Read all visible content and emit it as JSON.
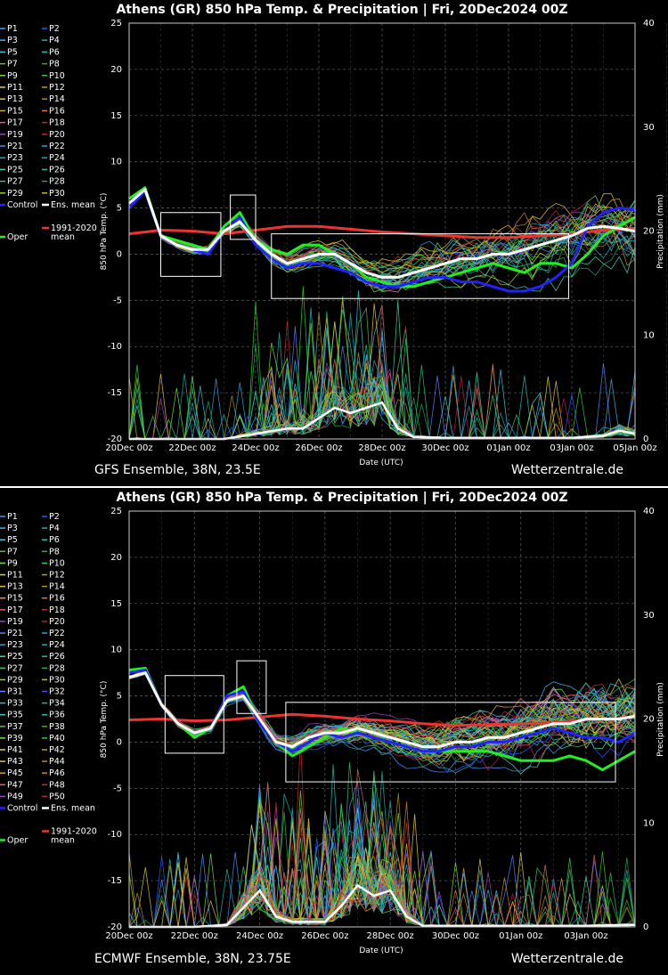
{
  "page": {
    "brand": "Wetterzentrale.de"
  },
  "chart_data": [
    {
      "type": "line",
      "title": "Athens  (GR)  850 hPa Temp. & Precipitation | Fri, 20Dec2024 00Z",
      "model": "GFS Ensemble, 38N, 23.5E",
      "source": "Wetterzentrale.de",
      "xlabel": "Date (UTC)",
      "ylabel": "850 hPa Temp. (°C)",
      "y2label": "Precipitation (mm)",
      "x_ticks": [
        "20Dec 00z",
        "22Dec 00z",
        "24Dec 00z",
        "26Dec 00z",
        "28Dec 00z",
        "30Dec 00z",
        "01Jan 00z",
        "03Jan 00z",
        "05Jan 00z"
      ],
      "x_range_days": [
        0,
        16
      ],
      "ylim": [
        -20,
        25
      ],
      "y_ticks": [
        "25",
        "20",
        "15",
        "10",
        "5",
        "0",
        "-5",
        "-10",
        "-15",
        "-20"
      ],
      "y2lim": [
        0,
        40
      ],
      "y2_ticks": [
        "40",
        "30",
        "20",
        "10",
        "0"
      ],
      "grid": true,
      "legend_position": "left",
      "members": [
        "P1",
        "P2",
        "P3",
        "P4",
        "P5",
        "P6",
        "P7",
        "P8",
        "P9",
        "P10",
        "P11",
        "P12",
        "P13",
        "P14",
        "P15",
        "P16",
        "P17",
        "P18",
        "P19",
        "P20",
        "P21",
        "P22",
        "P23",
        "P24",
        "P25",
        "P26",
        "P27",
        "P28",
        "P29",
        "P30"
      ],
      "legend_extra": {
        "control": "Control",
        "ens_mean": "Ens. mean",
        "climate": "1991-2020 mean",
        "oper": "Oper"
      },
      "colors": {
        "control": "#2222ff",
        "ens_mean": "#ffffff",
        "climate": "#ee3333",
        "oper": "#22ee22"
      },
      "series": [
        {
          "name": "Ens. mean",
          "x_days": [
            0,
            0.5,
            1,
            1.5,
            2,
            2.5,
            3,
            3.5,
            4,
            4.5,
            5,
            5.5,
            6,
            6.5,
            7,
            7.5,
            8,
            8.5,
            9,
            9.5,
            10,
            10.5,
            11,
            11.5,
            12,
            12.5,
            13,
            13.5,
            14,
            14.5,
            15,
            15.5,
            16
          ],
          "values": [
            5.5,
            7,
            2,
            1,
            0.5,
            0.5,
            2.5,
            3.5,
            1.5,
            0,
            -1,
            -0.5,
            0,
            0,
            -1,
            -2,
            -2.5,
            -2.5,
            -2,
            -1.5,
            -1,
            -0.5,
            -0.5,
            0,
            0,
            0.5,
            1,
            1.5,
            2,
            2.8,
            3,
            2.8,
            2.5
          ]
        },
        {
          "name": "Control",
          "x_days": [
            0,
            0.5,
            1,
            1.5,
            2,
            2.5,
            3,
            3.5,
            4,
            4.5,
            5,
            5.5,
            6,
            6.5,
            7,
            7.5,
            8,
            8.5,
            9,
            9.5,
            10,
            10.5,
            11,
            11.5,
            12,
            12.5,
            13,
            13.5,
            14,
            14.5,
            15,
            15.5,
            16
          ],
          "values": [
            5,
            6.8,
            2,
            1,
            0.5,
            0,
            2.5,
            4,
            1,
            -0.5,
            -1.5,
            -1,
            -1,
            -1.5,
            -2,
            -3,
            -3.5,
            -3.5,
            -3,
            -2.5,
            -2.5,
            -3,
            -3,
            -3.5,
            -4,
            -4,
            -3.5,
            -2.5,
            -1,
            3,
            4.5,
            5,
            4.8
          ]
        },
        {
          "name": "Oper",
          "x_days": [
            0,
            0.5,
            1,
            1.5,
            2,
            2.5,
            3,
            3.5,
            4,
            4.5,
            5,
            5.5,
            6,
            6.5,
            7,
            7.5,
            8,
            8.5,
            9,
            9.5,
            10,
            10.5,
            11,
            11.5,
            12,
            12.5,
            13,
            13.5,
            14,
            14.5,
            15,
            15.5,
            16
          ],
          "values": [
            6,
            7.2,
            2,
            1.5,
            1,
            0.5,
            3,
            4.5,
            1.5,
            0.5,
            0,
            1,
            1,
            0,
            -1,
            -2.5,
            -3,
            -3.5,
            -3.5,
            -3,
            -2.5,
            -2,
            -1.5,
            -1,
            -1.5,
            -2,
            -1,
            -1,
            -1.5,
            0,
            2,
            3,
            4
          ]
        },
        {
          "name": "1991-2020 mean",
          "x_days": [
            0,
            1,
            2,
            3,
            4,
            5,
            6,
            7,
            8,
            9,
            10,
            11,
            12,
            13,
            14,
            15,
            16
          ],
          "values": [
            2.2,
            2.6,
            2.5,
            2.2,
            2.6,
            3.0,
            3.0,
            2.7,
            2.4,
            2.2,
            2.0,
            1.8,
            1.8,
            2.0,
            2.2,
            2.6,
            2.8
          ]
        }
      ],
      "precip_mean": {
        "x_days": [
          0,
          1,
          2,
          3,
          4,
          5,
          5.5,
          6,
          6.5,
          7,
          7.5,
          8,
          8.5,
          9,
          10,
          12,
          14,
          15,
          15.5,
          16
        ],
        "values": [
          0,
          0,
          0,
          0,
          0.5,
          1,
          1,
          2,
          3,
          2.5,
          3,
          3.5,
          1,
          0.2,
          0.1,
          0.1,
          0.1,
          0.3,
          0.8,
          0.5
        ]
      },
      "highlight_boxes_days_temp": [
        [
          1,
          2.9,
          -2.4,
          4.5
        ],
        [
          3.2,
          4,
          1.6,
          6.4
        ],
        [
          4.5,
          13.9,
          -4.8,
          2.2
        ]
      ]
    },
    {
      "type": "line",
      "title": "Athens  (GR)  850 hPa Temp. & Precipitation | Fri, 20Dec2024 00Z",
      "model": "ECMWF Ensemble, 38N, 23.75E",
      "source": "Wetterzentrale.de",
      "xlabel": "Date (UTC)",
      "ylabel": "850 hPa Temp. (°C)",
      "y2label": "Precipitation (mm)",
      "x_ticks": [
        "20Dec 00z",
        "22Dec 00z",
        "24Dec 00z",
        "26Dec 00z",
        "28Dec 00z",
        "30Dec 00z",
        "01Jan 00z",
        "03Jan 00z"
      ],
      "x_range_days": [
        0,
        15.5
      ],
      "ylim": [
        -20,
        25
      ],
      "y_ticks": [
        "25",
        "20",
        "15",
        "10",
        "5",
        "0",
        "-5",
        "-10",
        "-15",
        "-20"
      ],
      "y2lim": [
        0,
        40
      ],
      "y2_ticks": [
        "40",
        "30",
        "20",
        "10",
        "0"
      ],
      "grid": true,
      "legend_position": "left",
      "members": [
        "P1",
        "P2",
        "P3",
        "P4",
        "P5",
        "P6",
        "P7",
        "P8",
        "P9",
        "P10",
        "P11",
        "P12",
        "P13",
        "P14",
        "P15",
        "P16",
        "P17",
        "P18",
        "P19",
        "P20",
        "P21",
        "P22",
        "P23",
        "P24",
        "P25",
        "P26",
        "P27",
        "P28",
        "P29",
        "P30",
        "P31",
        "P32",
        "P33",
        "P34",
        "P35",
        "P36",
        "P37",
        "P38",
        "P39",
        "P40",
        "P41",
        "P42",
        "P43",
        "P44",
        "P45",
        "P46",
        "P47",
        "P48",
        "P49",
        "P50"
      ],
      "legend_extra": {
        "control": "Control",
        "ens_mean": "Ens. mean",
        "climate": "1991-2020 mean",
        "oper": "Oper"
      },
      "colors": {
        "control": "#2222ff",
        "ens_mean": "#ffffff",
        "climate": "#ee3333",
        "oper": "#22ee22"
      },
      "series": [
        {
          "name": "Ens. mean",
          "x_days": [
            0,
            0.5,
            1,
            1.5,
            2,
            2.5,
            3,
            3.5,
            4,
            4.5,
            5,
            5.5,
            6,
            6.5,
            7,
            7.5,
            8,
            8.5,
            9,
            9.5,
            10,
            10.5,
            11,
            11.5,
            12,
            12.5,
            13,
            13.5,
            14,
            14.5,
            15,
            15.5
          ],
          "values": [
            7,
            7.5,
            4,
            2,
            1,
            1.5,
            4.5,
            5,
            2.5,
            0,
            -0.5,
            0.5,
            1,
            1,
            1.5,
            1,
            0.5,
            0,
            -0.5,
            -0.5,
            0,
            0,
            0.5,
            0.5,
            1,
            1.5,
            2,
            2,
            2.5,
            2.5,
            2.5,
            2.8
          ]
        },
        {
          "name": "Control",
          "x_days": [
            0,
            0.5,
            1,
            1.5,
            2,
            2.5,
            3,
            3.5,
            4,
            4.5,
            5,
            5.5,
            6,
            6.5,
            7,
            7.5,
            8,
            8.5,
            9,
            9.5,
            10,
            10.5,
            11,
            11.5,
            12,
            12.5,
            13,
            13.5,
            14,
            14.5,
            15,
            15.5
          ],
          "values": [
            7.5,
            7.8,
            4,
            2,
            1,
            1.5,
            5,
            5.5,
            2,
            0,
            -1,
            0,
            1,
            0.5,
            1,
            0.5,
            0,
            -0.5,
            -1,
            -1,
            -0.5,
            -0.5,
            0,
            0,
            0.5,
            1,
            1.5,
            1,
            0.5,
            0.5,
            0,
            1
          ]
        },
        {
          "name": "Oper",
          "x_days": [
            0,
            0.5,
            1,
            1.5,
            2,
            2.5,
            3,
            3.5,
            4,
            4.5,
            5,
            5.5,
            6,
            6.5,
            7,
            7.5,
            8,
            8.5,
            9,
            9.5,
            10,
            10.5,
            11,
            11.5,
            12,
            12.5,
            13,
            13.5,
            14,
            14.5,
            15,
            15.5
          ],
          "values": [
            7.8,
            8,
            4,
            2,
            0.5,
            1.5,
            5,
            6,
            2,
            0,
            -1.5,
            -0.5,
            0.5,
            1.5,
            1,
            0.5,
            0,
            -0.5,
            -1,
            -1,
            -1,
            -1,
            -1,
            -1.5,
            -2,
            -2,
            -2,
            -1.5,
            -2,
            -3,
            -2,
            -1
          ]
        },
        {
          "name": "1991-2020 mean",
          "x_days": [
            0,
            1,
            2,
            3,
            4,
            5,
            6,
            7,
            8,
            9,
            10,
            11,
            12,
            13,
            14,
            15,
            15.5
          ],
          "values": [
            2.4,
            2.5,
            2.3,
            2.4,
            2.7,
            3.0,
            2.8,
            2.5,
            2.3,
            2.0,
            1.8,
            1.9,
            2.0,
            2.1,
            2.4,
            2.6,
            2.8
          ]
        }
      ],
      "precip_mean": {
        "x_days": [
          0,
          1,
          2,
          3,
          4,
          4.5,
          5,
          6,
          6.5,
          7,
          7.5,
          8,
          8.5,
          9,
          10,
          12,
          14,
          15.5
        ],
        "values": [
          0,
          0,
          0,
          0.2,
          3.5,
          1,
          0.5,
          0.5,
          2,
          4,
          3,
          3.5,
          1,
          0.1,
          0.1,
          0.1,
          0.1,
          0.2
        ]
      },
      "highlight_boxes_days_temp": [
        [
          1.1,
          2.9,
          -1.2,
          7.2
        ],
        [
          3.3,
          4.2,
          3.1,
          8.8
        ],
        [
          4.8,
          14.9,
          -4.3,
          4.3
        ]
      ]
    }
  ]
}
